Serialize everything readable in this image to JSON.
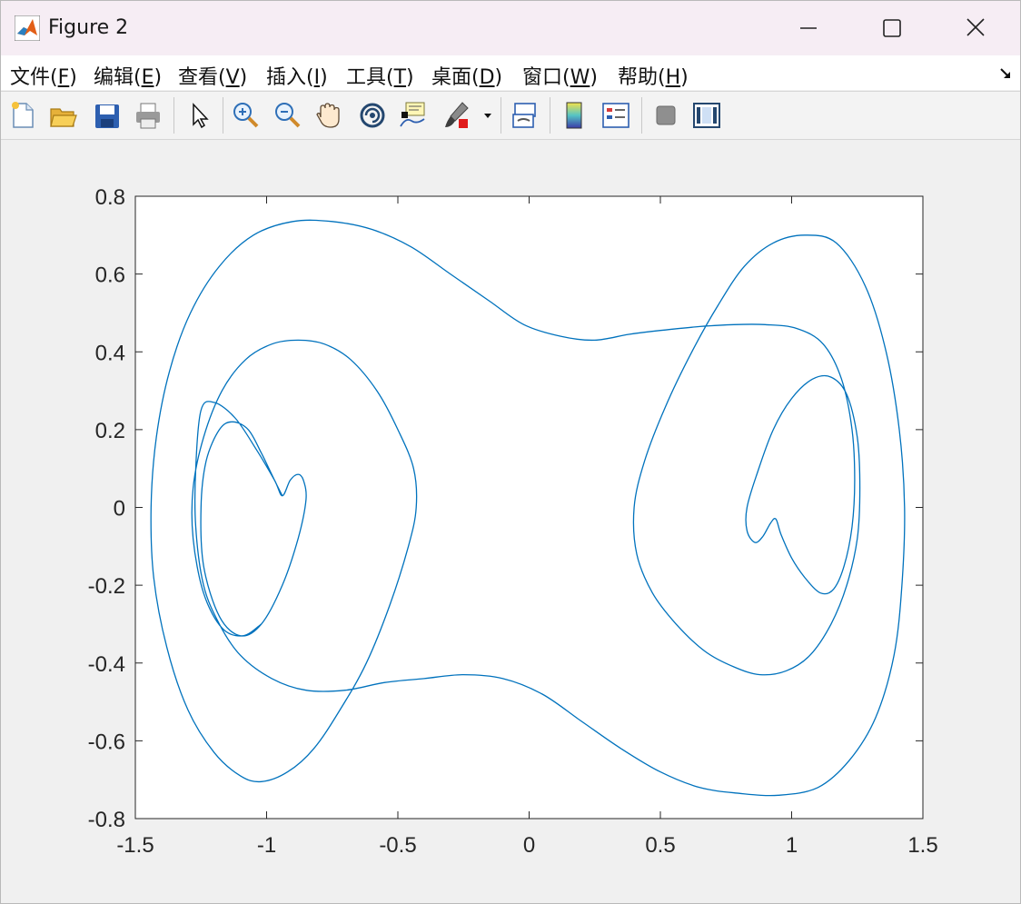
{
  "window": {
    "title": "Figure 2",
    "app_icon": "matlab-icon",
    "controls": [
      "minimize-icon",
      "maximize-icon",
      "close-icon"
    ]
  },
  "menubar": {
    "items": [
      {
        "label": "文件(",
        "accel": "F",
        "suffix": ")"
      },
      {
        "label": "编辑(",
        "accel": "E",
        "suffix": ")"
      },
      {
        "label": "查看(",
        "accel": "V",
        "suffix": ")"
      },
      {
        "label": "插入(",
        "accel": "I",
        "suffix": ")"
      },
      {
        "label": "工具(",
        "accel": "T",
        "suffix": ")"
      },
      {
        "label": "桌面(",
        "accel": "D",
        "suffix": ")"
      },
      {
        "label": "窗口(",
        "accel": "W",
        "suffix": ")"
      },
      {
        "label": "帮助(",
        "accel": "H",
        "suffix": ")"
      }
    ],
    "dock_icon": "dock-arrow-icon"
  },
  "toolbar": {
    "icons": [
      "new-figure-icon",
      "open-file-icon",
      "save-icon",
      "print-icon",
      "select-pointer-icon",
      "zoom-in-icon",
      "zoom-out-icon",
      "pan-hand-icon",
      "rotate-3d-icon",
      "data-cursor-icon",
      "brush-icon",
      "brush-dropdown-icon",
      "link-plot-icon",
      "colorbar-icon",
      "legend-icon",
      "hide-plot-tools-icon",
      "show-plot-tools-icon"
    ]
  },
  "colors": {
    "line": "#0072bd",
    "axes_bg": "#ffffff",
    "figure_bg": "#f0f0f0"
  },
  "chart_data": {
    "type": "line",
    "title": "",
    "xlabel": "",
    "ylabel": "",
    "xlim": [
      -1.5,
      1.5
    ],
    "ylim": [
      -0.8,
      0.8
    ],
    "xticks": [
      -1.5,
      -1,
      -0.5,
      0,
      0.5,
      1,
      1.5
    ],
    "xtick_labels": [
      "-1.5",
      "-1",
      "-0.5",
      "0",
      "0.5",
      "1",
      "1.5"
    ],
    "yticks": [
      -0.8,
      -0.6,
      -0.4,
      -0.2,
      0,
      0.2,
      0.4,
      0.6,
      0.8
    ],
    "ytick_labels": [
      "-0.8",
      "-0.6",
      "-0.4",
      "-0.2",
      "0",
      "0.2",
      "0.4",
      "0.6",
      "0.8"
    ],
    "grid": false,
    "legend": "none",
    "series": [
      {
        "color": "#0072bd",
        "points": [
          [
            -0.94,
            0.03
          ],
          [
            -0.97,
            0.07
          ],
          [
            -1.02,
            0.14
          ],
          [
            -1.07,
            0.2
          ],
          [
            -1.13,
            0.22
          ],
          [
            -1.18,
            0.2
          ],
          [
            -1.23,
            0.12
          ],
          [
            -1.25,
            0.0
          ],
          [
            -1.24,
            -0.15
          ],
          [
            -1.18,
            -0.28
          ],
          [
            -1.1,
            -0.33
          ],
          [
            -1.02,
            -0.3
          ],
          [
            -0.94,
            -0.2
          ],
          [
            -0.88,
            -0.08
          ],
          [
            -0.85,
            0.02
          ],
          [
            -0.86,
            0.07
          ],
          [
            -0.88,
            0.085
          ],
          [
            -0.91,
            0.07
          ],
          [
            -0.94,
            0.03
          ],
          [
            -0.97,
            0.07
          ],
          [
            -1.04,
            0.15
          ],
          [
            -1.12,
            0.23
          ],
          [
            -1.2,
            0.27
          ],
          [
            -1.25,
            0.25
          ],
          [
            -1.27,
            0.1
          ],
          [
            -1.27,
            -0.05
          ],
          [
            -1.24,
            -0.2
          ],
          [
            -1.18,
            -0.3
          ],
          [
            -1.1,
            -0.38
          ],
          [
            -0.98,
            -0.44
          ],
          [
            -0.85,
            -0.47
          ],
          [
            -0.7,
            -0.47
          ],
          [
            -0.55,
            -0.45
          ],
          [
            -0.4,
            -0.44
          ],
          [
            -0.25,
            -0.43
          ],
          [
            -0.1,
            -0.44
          ],
          [
            0.05,
            -0.48
          ],
          [
            0.2,
            -0.55
          ],
          [
            0.35,
            -0.62
          ],
          [
            0.5,
            -0.68
          ],
          [
            0.65,
            -0.72
          ],
          [
            0.8,
            -0.735
          ],
          [
            0.95,
            -0.74
          ],
          [
            1.1,
            -0.72
          ],
          [
            1.22,
            -0.65
          ],
          [
            1.32,
            -0.54
          ],
          [
            1.39,
            -0.38
          ],
          [
            1.42,
            -0.2
          ],
          [
            1.43,
            0.0
          ],
          [
            1.41,
            0.2
          ],
          [
            1.36,
            0.4
          ],
          [
            1.28,
            0.57
          ],
          [
            1.17,
            0.68
          ],
          [
            1.05,
            0.7
          ],
          [
            0.93,
            0.68
          ],
          [
            0.82,
            0.62
          ],
          [
            0.72,
            0.52
          ],
          [
            0.62,
            0.4
          ],
          [
            0.52,
            0.26
          ],
          [
            0.44,
            0.12
          ],
          [
            0.4,
            0.0
          ],
          [
            0.41,
            -0.12
          ],
          [
            0.47,
            -0.22
          ],
          [
            0.56,
            -0.3
          ],
          [
            0.67,
            -0.37
          ],
          [
            0.78,
            -0.41
          ],
          [
            0.88,
            -0.43
          ],
          [
            0.98,
            -0.42
          ],
          [
            1.07,
            -0.38
          ],
          [
            1.15,
            -0.3
          ],
          [
            1.21,
            -0.2
          ],
          [
            1.25,
            -0.08
          ],
          [
            1.26,
            0.05
          ],
          [
            1.25,
            0.18
          ],
          [
            1.21,
            0.29
          ],
          [
            1.15,
            0.335
          ],
          [
            1.08,
            0.33
          ],
          [
            1.0,
            0.28
          ],
          [
            0.93,
            0.2
          ],
          [
            0.87,
            0.09
          ],
          [
            0.83,
            0.0
          ],
          [
            0.83,
            -0.06
          ],
          [
            0.86,
            -0.09
          ],
          [
            0.89,
            -0.075
          ],
          [
            0.92,
            -0.04
          ],
          [
            0.94,
            -0.03
          ],
          [
            0.96,
            -0.07
          ],
          [
            1.0,
            -0.13
          ],
          [
            1.05,
            -0.18
          ],
          [
            1.11,
            -0.22
          ],
          [
            1.16,
            -0.21
          ],
          [
            1.2,
            -0.15
          ],
          [
            1.23,
            -0.05
          ],
          [
            1.24,
            0.07
          ],
          [
            1.23,
            0.2
          ],
          [
            1.19,
            0.33
          ],
          [
            1.12,
            0.42
          ],
          [
            1.02,
            0.46
          ],
          [
            0.9,
            0.47
          ],
          [
            0.78,
            0.47
          ],
          [
            0.65,
            0.465
          ],
          [
            0.5,
            0.455
          ],
          [
            0.38,
            0.445
          ],
          [
            0.25,
            0.43
          ],
          [
            0.12,
            0.44
          ],
          [
            -0.02,
            0.47
          ],
          [
            -0.15,
            0.53
          ],
          [
            -0.3,
            0.6
          ],
          [
            -0.45,
            0.67
          ],
          [
            -0.6,
            0.715
          ],
          [
            -0.75,
            0.735
          ],
          [
            -0.9,
            0.735
          ],
          [
            -1.05,
            0.7
          ],
          [
            -1.18,
            0.62
          ],
          [
            -1.29,
            0.5
          ],
          [
            -1.37,
            0.35
          ],
          [
            -1.42,
            0.18
          ],
          [
            -1.44,
            0.0
          ],
          [
            -1.43,
            -0.18
          ],
          [
            -1.38,
            -0.36
          ],
          [
            -1.3,
            -0.52
          ],
          [
            -1.2,
            -0.63
          ],
          [
            -1.1,
            -0.69
          ],
          [
            -1.02,
            -0.705
          ],
          [
            -0.92,
            -0.68
          ],
          [
            -0.82,
            -0.62
          ],
          [
            -0.72,
            -0.52
          ],
          [
            -0.62,
            -0.4
          ],
          [
            -0.53,
            -0.25
          ],
          [
            -0.46,
            -0.1
          ],
          [
            -0.43,
            0.0
          ],
          [
            -0.44,
            0.1
          ],
          [
            -0.5,
            0.2
          ],
          [
            -0.58,
            0.3
          ],
          [
            -0.68,
            0.38
          ],
          [
            -0.78,
            0.42
          ],
          [
            -0.88,
            0.43
          ],
          [
            -0.98,
            0.42
          ],
          [
            -1.08,
            0.38
          ],
          [
            -1.17,
            0.3
          ],
          [
            -1.24,
            0.18
          ],
          [
            -1.28,
            0.05
          ],
          [
            -1.28,
            -0.08
          ],
          [
            -1.24,
            -0.22
          ],
          [
            -1.17,
            -0.31
          ],
          [
            -1.09,
            -0.33
          ],
          [
            -1.02,
            -0.3
          ]
        ]
      }
    ]
  }
}
